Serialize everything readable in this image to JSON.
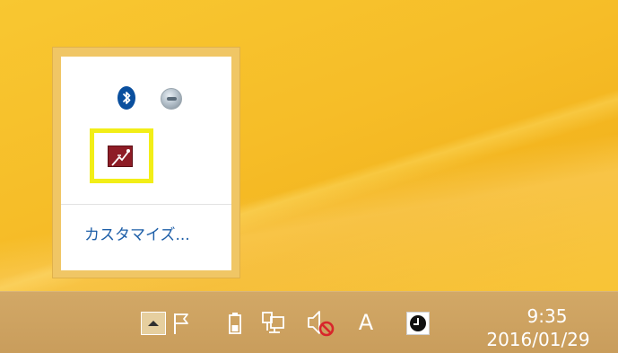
{
  "overflow_panel": {
    "customize_label": "カスタマイズ...",
    "icons": [
      "bluetooth-icon",
      "sync-icon",
      "app-icon"
    ],
    "highlight_color": "#f2ee17"
  },
  "taskbar": {
    "ime_label": "A",
    "time": "9:35",
    "date": "2016/01/29",
    "icons": [
      "show-hidden-icons-chevron",
      "action-center-flag-icon",
      "battery-icon",
      "network-icon",
      "volume-muted-icon",
      "ime-icon",
      "clock-app-icon"
    ]
  },
  "colors": {
    "desktop_accent": "#f6bd28",
    "taskbar_bg": "#c99d5c",
    "link_blue": "#1e5fa8"
  }
}
